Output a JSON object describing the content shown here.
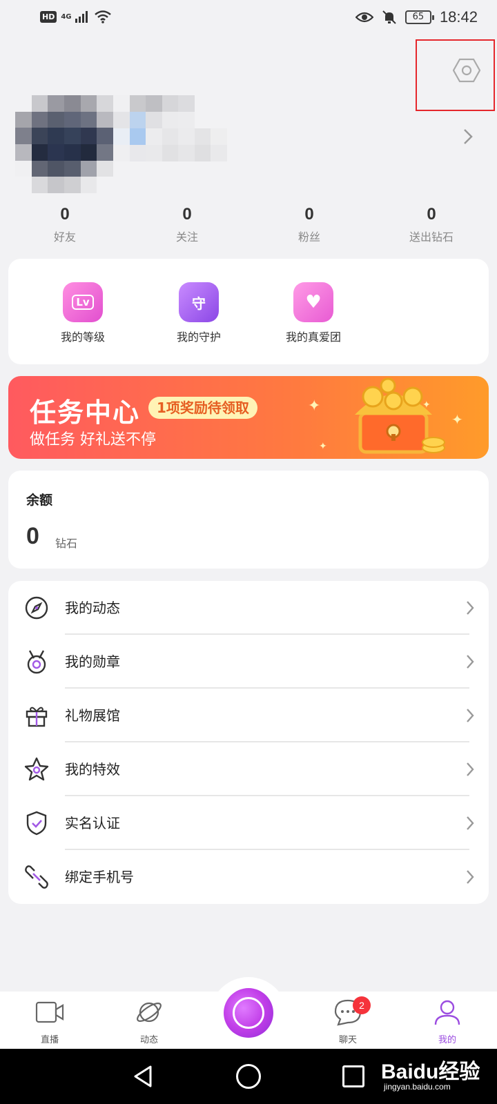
{
  "status_bar": {
    "left_badge": "HD",
    "network": "4G",
    "battery": "65",
    "time": "18:42"
  },
  "profile": {
    "settings_icon": "gear-hex-icon",
    "chevron_icon": "chevron-right-icon"
  },
  "stats": [
    {
      "value": "0",
      "label": "好友"
    },
    {
      "value": "0",
      "label": "关注"
    },
    {
      "value": "0",
      "label": "粉丝"
    },
    {
      "value": "0",
      "label": "送出钻石"
    }
  ],
  "privileges": [
    {
      "label": "我的等级",
      "icon_text": "Lv",
      "icon": "level-icon"
    },
    {
      "label": "我的守护",
      "icon_text": "守",
      "icon": "guard-icon"
    },
    {
      "label": "我的真爱团",
      "icon_text": "♥",
      "icon": "love-group-icon"
    }
  ],
  "task_banner": {
    "title": "任务中心",
    "badge": "1项奖励待领取",
    "subtitle": "做任务 好礼送不停"
  },
  "balance": {
    "title": "余额",
    "value": "0",
    "unit": "钻石"
  },
  "menu": [
    {
      "label": "我的动态",
      "icon": "compass-icon"
    },
    {
      "label": "我的勋章",
      "icon": "medal-icon"
    },
    {
      "label": "礼物展馆",
      "icon": "gift-icon"
    },
    {
      "label": "我的特效",
      "icon": "star-icon"
    },
    {
      "label": "实名认证",
      "icon": "shield-check-icon"
    },
    {
      "label": "绑定手机号",
      "icon": "link-icon"
    }
  ],
  "bottom_nav": [
    {
      "label": "直播",
      "icon": "video-camera-icon"
    },
    {
      "label": "动态",
      "icon": "planet-icon"
    },
    {
      "label": "聊天",
      "icon": "chat-bubble-icon",
      "badge": "2"
    },
    {
      "label": "我的",
      "icon": "person-icon",
      "active": true
    }
  ],
  "watermark": {
    "logo": "Baidu经验",
    "url": "jingyan.baidu.com"
  },
  "colors": {
    "accent": "#9b4ce0",
    "badge_red": "#f5333b",
    "highlight_box": "#e5262b"
  }
}
